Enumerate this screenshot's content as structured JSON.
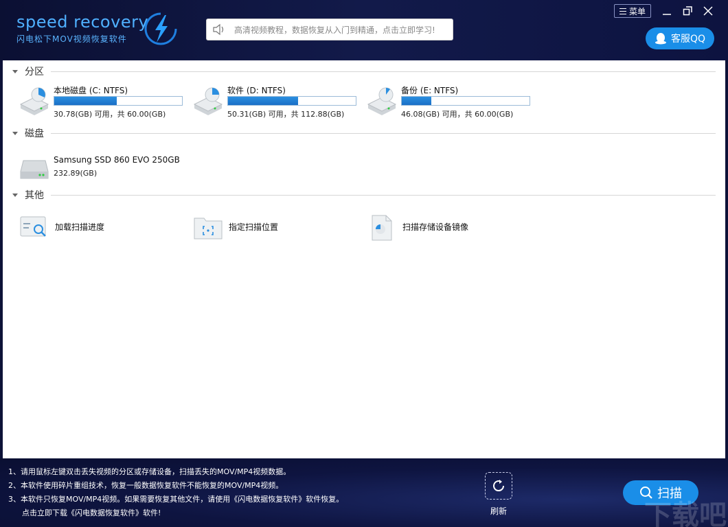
{
  "header": {
    "logo_title": "speed recovery",
    "logo_subtitle": "闪电松下MOV视频恢复软件",
    "notice_text": "高清视频教程，数据恢复从入门到精通，点击立即学习!",
    "menu_label": "菜单",
    "qq_label": "客服QQ"
  },
  "sections": {
    "partition": "分区",
    "disk": "磁盘",
    "other": "其他"
  },
  "partitions": [
    {
      "name": "本地磁盘 (C: NTFS)",
      "info": "30.78(GB) 可用，共 60.00(GB)",
      "used_fraction": 0.49
    },
    {
      "name": "软件 (D: NTFS)",
      "info": "50.31(GB) 可用，共 112.88(GB)",
      "used_fraction": 0.55
    },
    {
      "name": "备份 (E: NTFS)",
      "info": "46.08(GB) 可用，共 60.00(GB)",
      "used_fraction": 0.23
    }
  ],
  "disks": [
    {
      "name": "Samsung SSD 860 EVO 250GB",
      "info": "232.89(GB)"
    }
  ],
  "others": [
    {
      "label": "加载扫描进度",
      "icon": "load-progress-icon"
    },
    {
      "label": "指定扫描位置",
      "icon": "folder-target-icon"
    },
    {
      "label": "扫描存储设备镜像",
      "icon": "disk-image-icon"
    }
  ],
  "footer": {
    "tips": [
      "1、请用鼠标左键双击丢失视频的分区或存储设备，扫描丢失的MOV/MP4视频数据。",
      "2、本软件使用碎片重组技术，恢复一般数据恢复软件不能恢复的MOV/MP4视频。",
      "3、本软件只恢复MOV/MP4视频。如果需要恢复其他文件，请使用《闪电数据恢复软件》软件恢复。",
      "点击立即下载《闪电数据恢复软件》软件!"
    ],
    "refresh_label": "刷新",
    "scan_label": "扫描",
    "watermark": "下载吧"
  },
  "colors": {
    "header_bg": "#0b1033",
    "accent": "#1a8ee8",
    "bar_fill": "#2b8fe0"
  }
}
